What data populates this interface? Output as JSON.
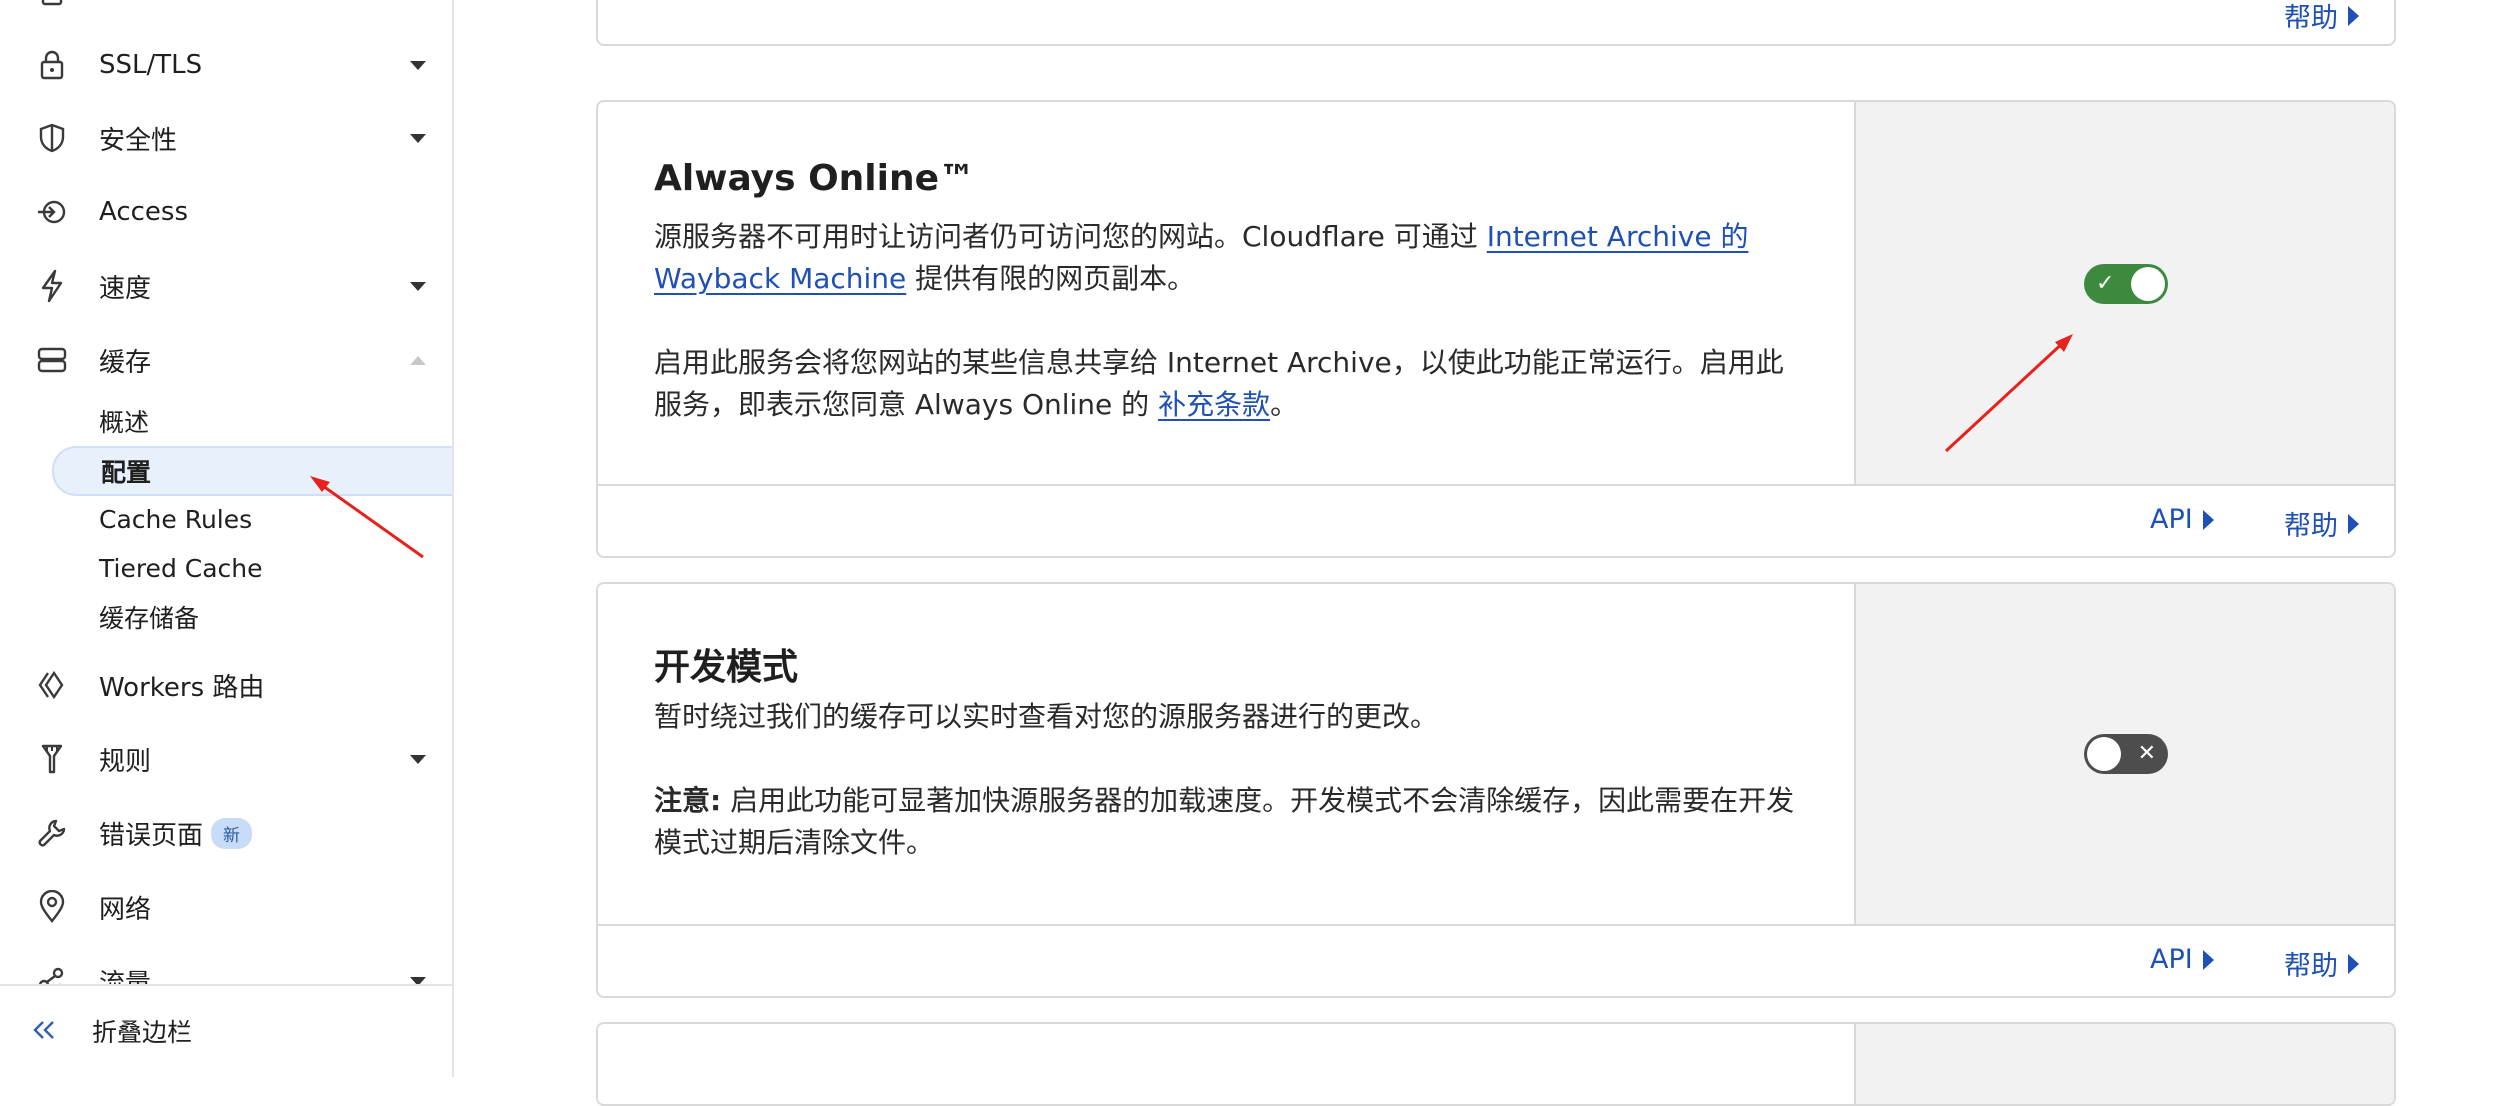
{
  "sidebar": {
    "items": [
      {
        "label": "SSL/TLS",
        "icon": "lock-icon"
      },
      {
        "label": "安全性",
        "icon": "shield-icon"
      },
      {
        "label": "Access",
        "icon": "access-icon"
      },
      {
        "label": "速度",
        "icon": "lightning-icon"
      },
      {
        "label": "缓存",
        "icon": "storage-icon"
      },
      {
        "label": "Workers 路由",
        "icon": "workers-icon"
      },
      {
        "label": "规则",
        "icon": "rules-icon"
      },
      {
        "label": "错误页面",
        "icon": "wrench-icon",
        "badge": "新"
      },
      {
        "label": "网络",
        "icon": "location-pin-icon"
      },
      {
        "label": "流量",
        "icon": "traffic-icon"
      }
    ],
    "cache_sub_items": [
      {
        "label": "概述"
      },
      {
        "label": "配置",
        "active": true
      },
      {
        "label": "Cache Rules"
      },
      {
        "label": "Tiered Cache"
      },
      {
        "label": "缓存储备"
      }
    ],
    "collapse_label": "折叠边栏"
  },
  "cards": {
    "top_card": {
      "help_label": "帮助"
    },
    "always_online": {
      "title": "Always Online™",
      "desc_1_prefix": "源服务器不可用时让访问者仍可访问您的网站。Cloudflare 可通过 ",
      "desc_1_link": "Internet Archive 的 Wayback Machine",
      "desc_1_suffix": " 提供有限的网页副本。",
      "desc_2_prefix": "启用此服务会将您网站的某些信息共享给 Internet Archive，以使此功能正常运行。启用此服务，即表示您同意 Always Online 的 ",
      "desc_2_link": "补充条款",
      "desc_2_suffix": "。",
      "toggle_state": "on",
      "api_label": "API",
      "help_label": "帮助"
    },
    "dev_mode": {
      "title": "开发模式",
      "desc_1": "暂时绕过我们的缓存可以实时查看对您的源服务器进行的更改。",
      "note_label": "注意:",
      "note_text": " 启用此功能可显著加快源服务器的加载速度。开发模式不会清除缓存，因此需要在开发模式过期后清除文件。",
      "toggle_state": "off",
      "api_label": "API",
      "help_label": "帮助"
    }
  },
  "colors": {
    "accent": "#1f50b5",
    "toggle_on": "#3d8a3f",
    "toggle_off": "#4d4d4d",
    "annotation_arrow": "#e8211c"
  }
}
